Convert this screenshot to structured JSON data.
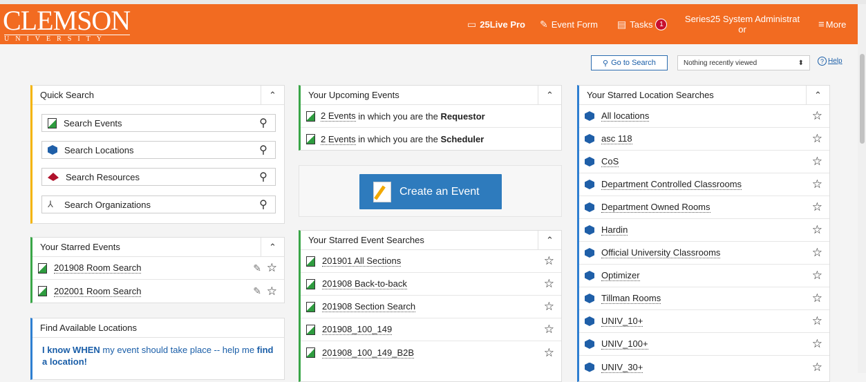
{
  "header": {
    "logo_main": "CLEMSON",
    "logo_sub": "UNIVERSITY",
    "nav_25live": "25Live Pro",
    "nav_event_form": "Event Form",
    "nav_tasks": "Tasks",
    "tasks_count": "1",
    "user_line1": "Series25 System Administrat",
    "user_line2": "or",
    "nav_more": "More"
  },
  "utility": {
    "go_to_search": "Go to Search",
    "recent_viewed": "Nothing recently viewed",
    "help": "Help"
  },
  "quick_search": {
    "title": "Quick Search",
    "items": [
      "Search Events",
      "Search Locations",
      "Search Resources",
      "Search Organizations"
    ]
  },
  "starred_events": {
    "title": "Your Starred Events",
    "items": [
      "201908 Room Search",
      "202001 Room Search"
    ]
  },
  "find_locations": {
    "title": "Find Available Locations",
    "bold1": "I know WHEN",
    "text": " my event should take place -- help me ",
    "bold2": "find a location!"
  },
  "upcoming": {
    "title": "Your Upcoming Events",
    "rows": [
      {
        "link": "2 Events",
        "text": " in which you are the ",
        "bold": "Requestor"
      },
      {
        "link": "2 Events",
        "text": " in which you are the ",
        "bold": "Scheduler"
      }
    ]
  },
  "create_event": {
    "label": "Create an Event"
  },
  "starred_event_searches": {
    "title": "Your Starred Event Searches",
    "items": [
      "201901 All Sections",
      "201908 Back-to-back",
      "201908 Section Search",
      "201908_100_149",
      "201908_100_149_B2B"
    ]
  },
  "starred_location_searches": {
    "title": "Your Starred Location Searches",
    "items": [
      "All locations",
      "asc 118",
      "CoS",
      "Department Controlled Classrooms",
      "Department Owned Rooms",
      "Hardin",
      "Official University Classrooms",
      "Optimizer",
      "Tillman Rooms",
      "UNIV_10+",
      "UNIV_100+",
      "UNIV_30+"
    ]
  }
}
